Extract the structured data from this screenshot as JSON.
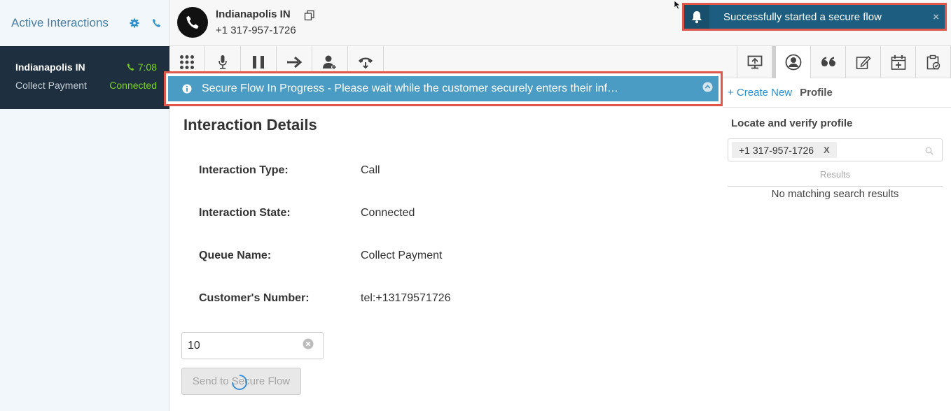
{
  "sidebar": {
    "title": "Active Interactions",
    "interaction": {
      "name": "Indianapolis IN",
      "timer": "7:08",
      "queue": "Collect Payment",
      "state": "Connected"
    }
  },
  "header": {
    "caller_name": "Indianapolis IN",
    "caller_number": "+1 317-957-1726"
  },
  "toast": {
    "message": "Successfully started a secure flow",
    "close": "×"
  },
  "banner": {
    "message": "Secure Flow In Progress - Please wait while the customer securely enters their inf…"
  },
  "main": {
    "title": "Interaction Details",
    "details": [
      {
        "label": "Interaction Type:",
        "value": "Call"
      },
      {
        "label": "Interaction State:",
        "value": "Connected"
      },
      {
        "label": "Queue Name:",
        "value": "Collect Payment"
      },
      {
        "label": "Customer's Number:",
        "value": "tel:+13179571726"
      }
    ],
    "amount_value": "10",
    "send_button": "Send to Secure Flow"
  },
  "right_panel": {
    "create_new": "+ Create New",
    "profile_tab": "Profile",
    "section_title": "Locate and verify profile",
    "search_chip": "+1 317-957-1726",
    "chip_remove": "X",
    "results_label": "Results",
    "no_results": "No matching search results"
  },
  "colors": {
    "sidebar_card_bg": "#1e3040",
    "connected_green": "#7ed321",
    "toast_bg": "#1d5e80",
    "banner_bg": "#4a9cc4",
    "highlight_red": "#e0574b",
    "link_blue": "#2a8fd0"
  }
}
